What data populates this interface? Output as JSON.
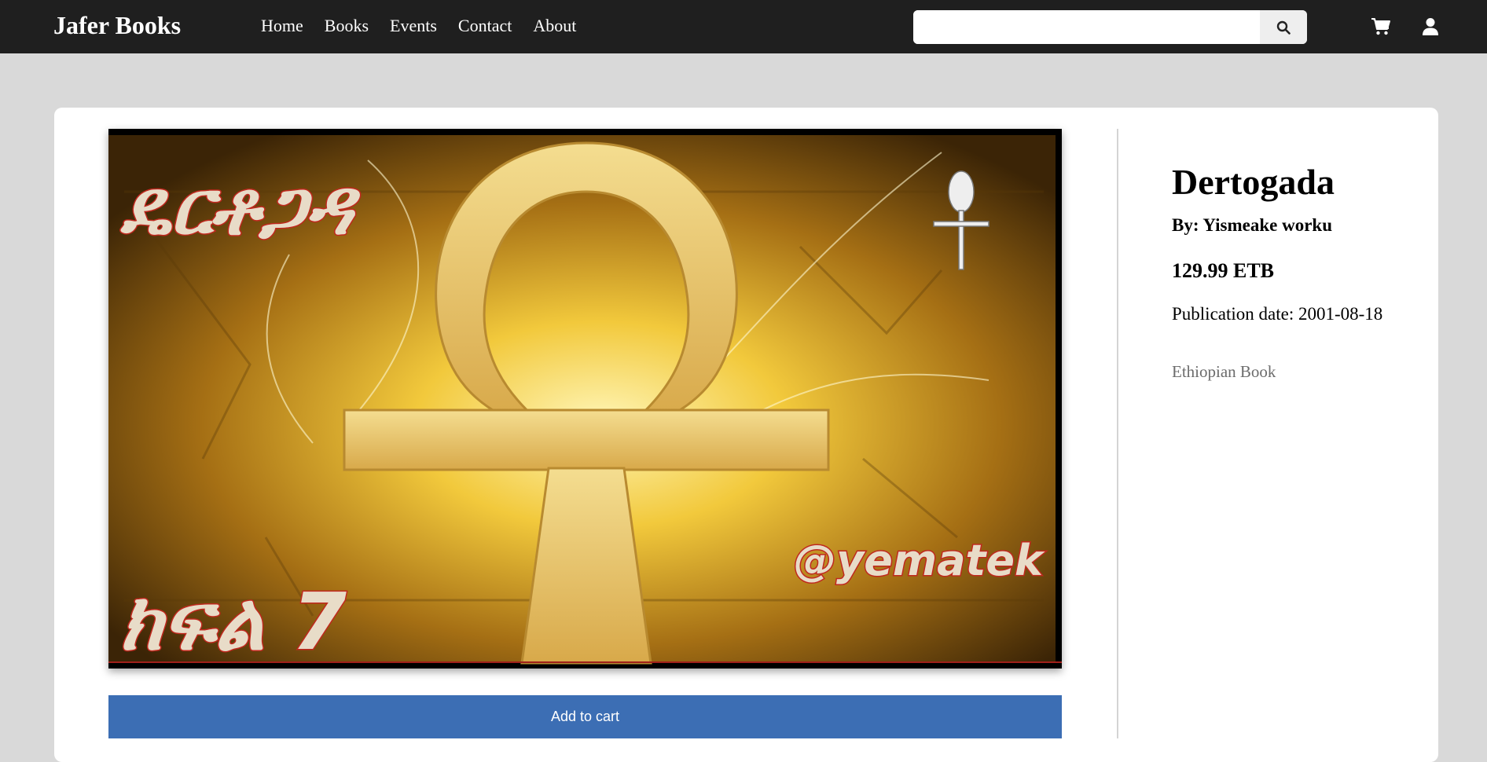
{
  "navbar": {
    "brand": "Jafer Books",
    "links": [
      "Home",
      "Books",
      "Events",
      "Contact",
      "About"
    ],
    "search_placeholder": "",
    "icons": [
      "search-icon",
      "cart-icon",
      "user-icon"
    ]
  },
  "book": {
    "title": "Dertogada",
    "author": "By: Yismeake worku",
    "price": "129.99 ETB",
    "publication_date": "Publication date: 2001-08-18",
    "category": "Ethiopian Book",
    "cover_texts": {
      "title_amharic": "ዴርቶጋዳ",
      "part": "ክፍል 7",
      "handle": "@yematek"
    }
  },
  "actions": {
    "add_to_cart": "Add to cart"
  },
  "colors": {
    "navbar": "#1f1f1f",
    "background": "#d9d9d9",
    "card": "#ffffff",
    "primary_button": "#3c6eb4",
    "category_text": "#6c6c6c"
  }
}
